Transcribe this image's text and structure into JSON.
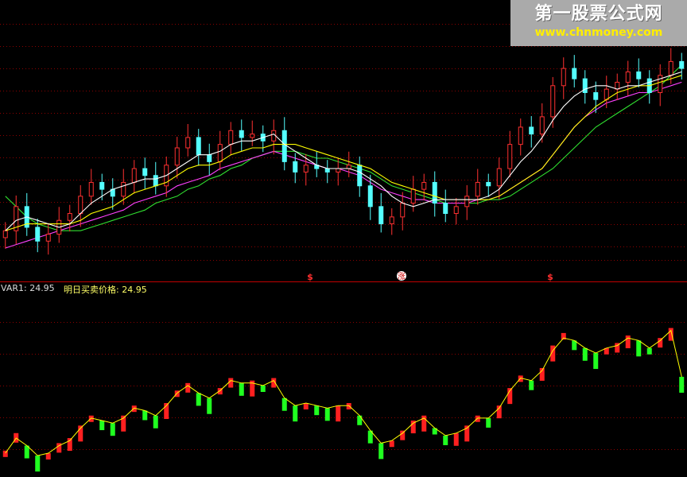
{
  "indicator": {
    "var1_label": "VAR1: 24.95",
    "price_label": "明日买卖价格: 24.95"
  },
  "markers": [
    "$",
    "涨",
    "$"
  ],
  "watermark": {
    "title": "第一股票公式网",
    "url": "www.chnmoney.com"
  },
  "colors": {
    "up_candle": "#ff3030",
    "down_candle": "#54ffff",
    "ma_short": "#ffffff",
    "ma_mid": "#ffff00",
    "ma_30": "#ff40ff",
    "ma_long": "#30e030",
    "indicator_up": "#ff2020",
    "indicator_down": "#20ff20",
    "indicator_line": "#ffff00",
    "grid": "#8b0000",
    "divider": "#c00000"
  },
  "chart_data": [
    {
      "type": "candlestick",
      "xlabel": "",
      "ylabel": "",
      "closes": [
        22.0,
        22.7,
        22.1,
        21.7,
        21.9,
        22.3,
        22.5,
        23.0,
        23.4,
        23.2,
        23.0,
        23.4,
        23.8,
        23.6,
        23.3,
        23.9,
        24.4,
        24.7,
        24.2,
        24.0,
        24.5,
        24.9,
        24.7,
        24.8,
        24.6,
        24.9,
        24.0,
        23.7,
        23.9,
        23.8,
        23.7,
        23.8,
        23.9,
        23.3,
        22.7,
        22.2,
        22.4,
        22.8,
        23.2,
        23.4,
        22.8,
        22.5,
        22.7,
        23.0,
        23.4,
        23.3,
        23.8,
        24.5,
        25.0,
        24.8,
        25.3,
        26.2,
        26.7,
        26.4,
        26.0,
        25.8,
        26.1,
        26.3,
        26.6,
        26.4,
        26.0,
        26.5,
        26.9,
        26.7
      ],
      "ma5": [
        22.0,
        22.3,
        22.4,
        22.3,
        22.2,
        22.1,
        22.2,
        22.5,
        22.8,
        23.0,
        23.2,
        23.3,
        23.4,
        23.5,
        23.5,
        23.6,
        23.8,
        24.0,
        24.2,
        24.2,
        24.3,
        24.5,
        24.6,
        24.6,
        24.7,
        24.8,
        24.5,
        24.3,
        24.1,
        23.9,
        23.8,
        23.8,
        23.8,
        23.7,
        23.5,
        23.3,
        23.0,
        22.8,
        22.7,
        22.8,
        22.9,
        22.9,
        22.9,
        22.9,
        22.9,
        23.0,
        23.2,
        23.6,
        24.0,
        24.3,
        24.7,
        25.2,
        25.6,
        25.9,
        26.1,
        26.2,
        26.2,
        26.1,
        26.2,
        26.2,
        26.3,
        26.4,
        26.5,
        26.6
      ],
      "ma10": [
        22.0,
        22.1,
        22.2,
        22.2,
        22.2,
        22.2,
        22.2,
        22.3,
        22.5,
        22.6,
        22.7,
        22.9,
        23.1,
        23.2,
        23.3,
        23.4,
        23.6,
        23.8,
        23.9,
        23.9,
        24.0,
        24.2,
        24.3,
        24.4,
        24.4,
        24.5,
        24.5,
        24.5,
        24.4,
        24.3,
        24.2,
        24.1,
        24.0,
        23.9,
        23.8,
        23.6,
        23.4,
        23.3,
        23.2,
        23.1,
        23.0,
        22.9,
        22.9,
        22.9,
        22.9,
        22.9,
        23.0,
        23.2,
        23.4,
        23.6,
        23.8,
        24.2,
        24.6,
        25.0,
        25.3,
        25.6,
        25.8,
        26.0,
        26.1,
        26.2,
        26.2,
        26.3,
        26.4,
        26.5
      ],
      "ma30": [
        21.5,
        21.6,
        21.7,
        21.8,
        21.9,
        22.0,
        22.1,
        22.2,
        22.3,
        22.4,
        22.5,
        22.6,
        22.8,
        22.9,
        23.0,
        23.1,
        23.3,
        23.4,
        23.5,
        23.6,
        23.8,
        23.9,
        24.0,
        24.1,
        24.2,
        24.3,
        24.2,
        24.1,
        24.0,
        23.9,
        23.8,
        23.8,
        23.7,
        23.6,
        23.4,
        23.2,
        23.1,
        23.0,
        22.9,
        22.9,
        22.8,
        22.8,
        22.8,
        22.8,
        22.9,
        22.9,
        23.0,
        23.2,
        23.4,
        23.6,
        23.8,
        24.2,
        24.6,
        25.0,
        25.3,
        25.5,
        25.7,
        25.8,
        25.9,
        26.0,
        26.0,
        26.1,
        26.2,
        26.3
      ],
      "ma60": [
        23.0,
        22.7,
        22.4,
        22.2,
        22.1,
        22.0,
        22.0,
        22.0,
        22.1,
        22.2,
        22.3,
        22.4,
        22.5,
        22.6,
        22.8,
        22.9,
        23.0,
        23.2,
        23.3,
        23.5,
        23.6,
        23.8,
        23.9,
        24.1,
        24.2,
        24.3,
        24.3,
        24.3,
        24.2,
        24.1,
        24.1,
        24.0,
        23.9,
        23.8,
        23.7,
        23.5,
        23.3,
        23.2,
        23.1,
        23.0,
        22.9,
        22.8,
        22.8,
        22.8,
        22.8,
        22.9,
        22.9,
        23.0,
        23.2,
        23.4,
        23.6,
        23.8,
        24.1,
        24.4,
        24.7,
        25.0,
        25.2,
        25.4,
        25.6,
        25.8,
        26.0,
        26.2,
        26.5,
        26.8
      ]
    },
    {
      "type": "bar",
      "xlabel": "",
      "ylabel": "",
      "series": [
        {
          "name": "VAR1",
          "values": [
            22.0,
            22.7,
            22.1,
            21.7,
            21.9,
            22.3,
            22.5,
            23.0,
            23.4,
            23.2,
            23.0,
            23.4,
            23.8,
            23.6,
            23.3,
            23.9,
            24.4,
            24.7,
            24.2,
            24.0,
            24.5,
            24.9,
            24.7,
            24.8,
            24.6,
            24.9,
            24.0,
            23.7,
            23.9,
            23.8,
            23.7,
            23.8,
            23.9,
            23.3,
            22.7,
            22.2,
            22.4,
            22.8,
            23.2,
            23.4,
            22.8,
            22.5,
            22.7,
            23.0,
            23.4,
            23.3,
            23.8,
            24.5,
            25.0,
            24.8,
            25.3,
            26.2,
            26.7,
            26.4,
            26.0,
            25.8,
            26.1,
            26.3,
            26.6,
            26.4,
            26.0,
            26.5,
            26.9,
            24.95
          ]
        },
        {
          "name": "明日买卖价格",
          "values": [
            21.9,
            22.5,
            22.2,
            21.8,
            21.9,
            22.2,
            22.4,
            22.9,
            23.3,
            23.2,
            23.1,
            23.3,
            23.7,
            23.6,
            23.4,
            23.8,
            24.3,
            24.6,
            24.3,
            24.1,
            24.4,
            24.8,
            24.7,
            24.7,
            24.6,
            24.8,
            24.1,
            23.8,
            23.9,
            23.8,
            23.7,
            23.8,
            23.8,
            23.4,
            22.8,
            22.3,
            22.4,
            22.7,
            23.1,
            23.3,
            22.9,
            22.6,
            22.7,
            22.9,
            23.3,
            23.3,
            23.7,
            24.4,
            24.9,
            24.8,
            25.2,
            26.0,
            26.5,
            26.4,
            26.1,
            25.9,
            26.1,
            26.2,
            26.5,
            26.4,
            26.1,
            26.4,
            26.8,
            24.95
          ]
        }
      ]
    }
  ]
}
